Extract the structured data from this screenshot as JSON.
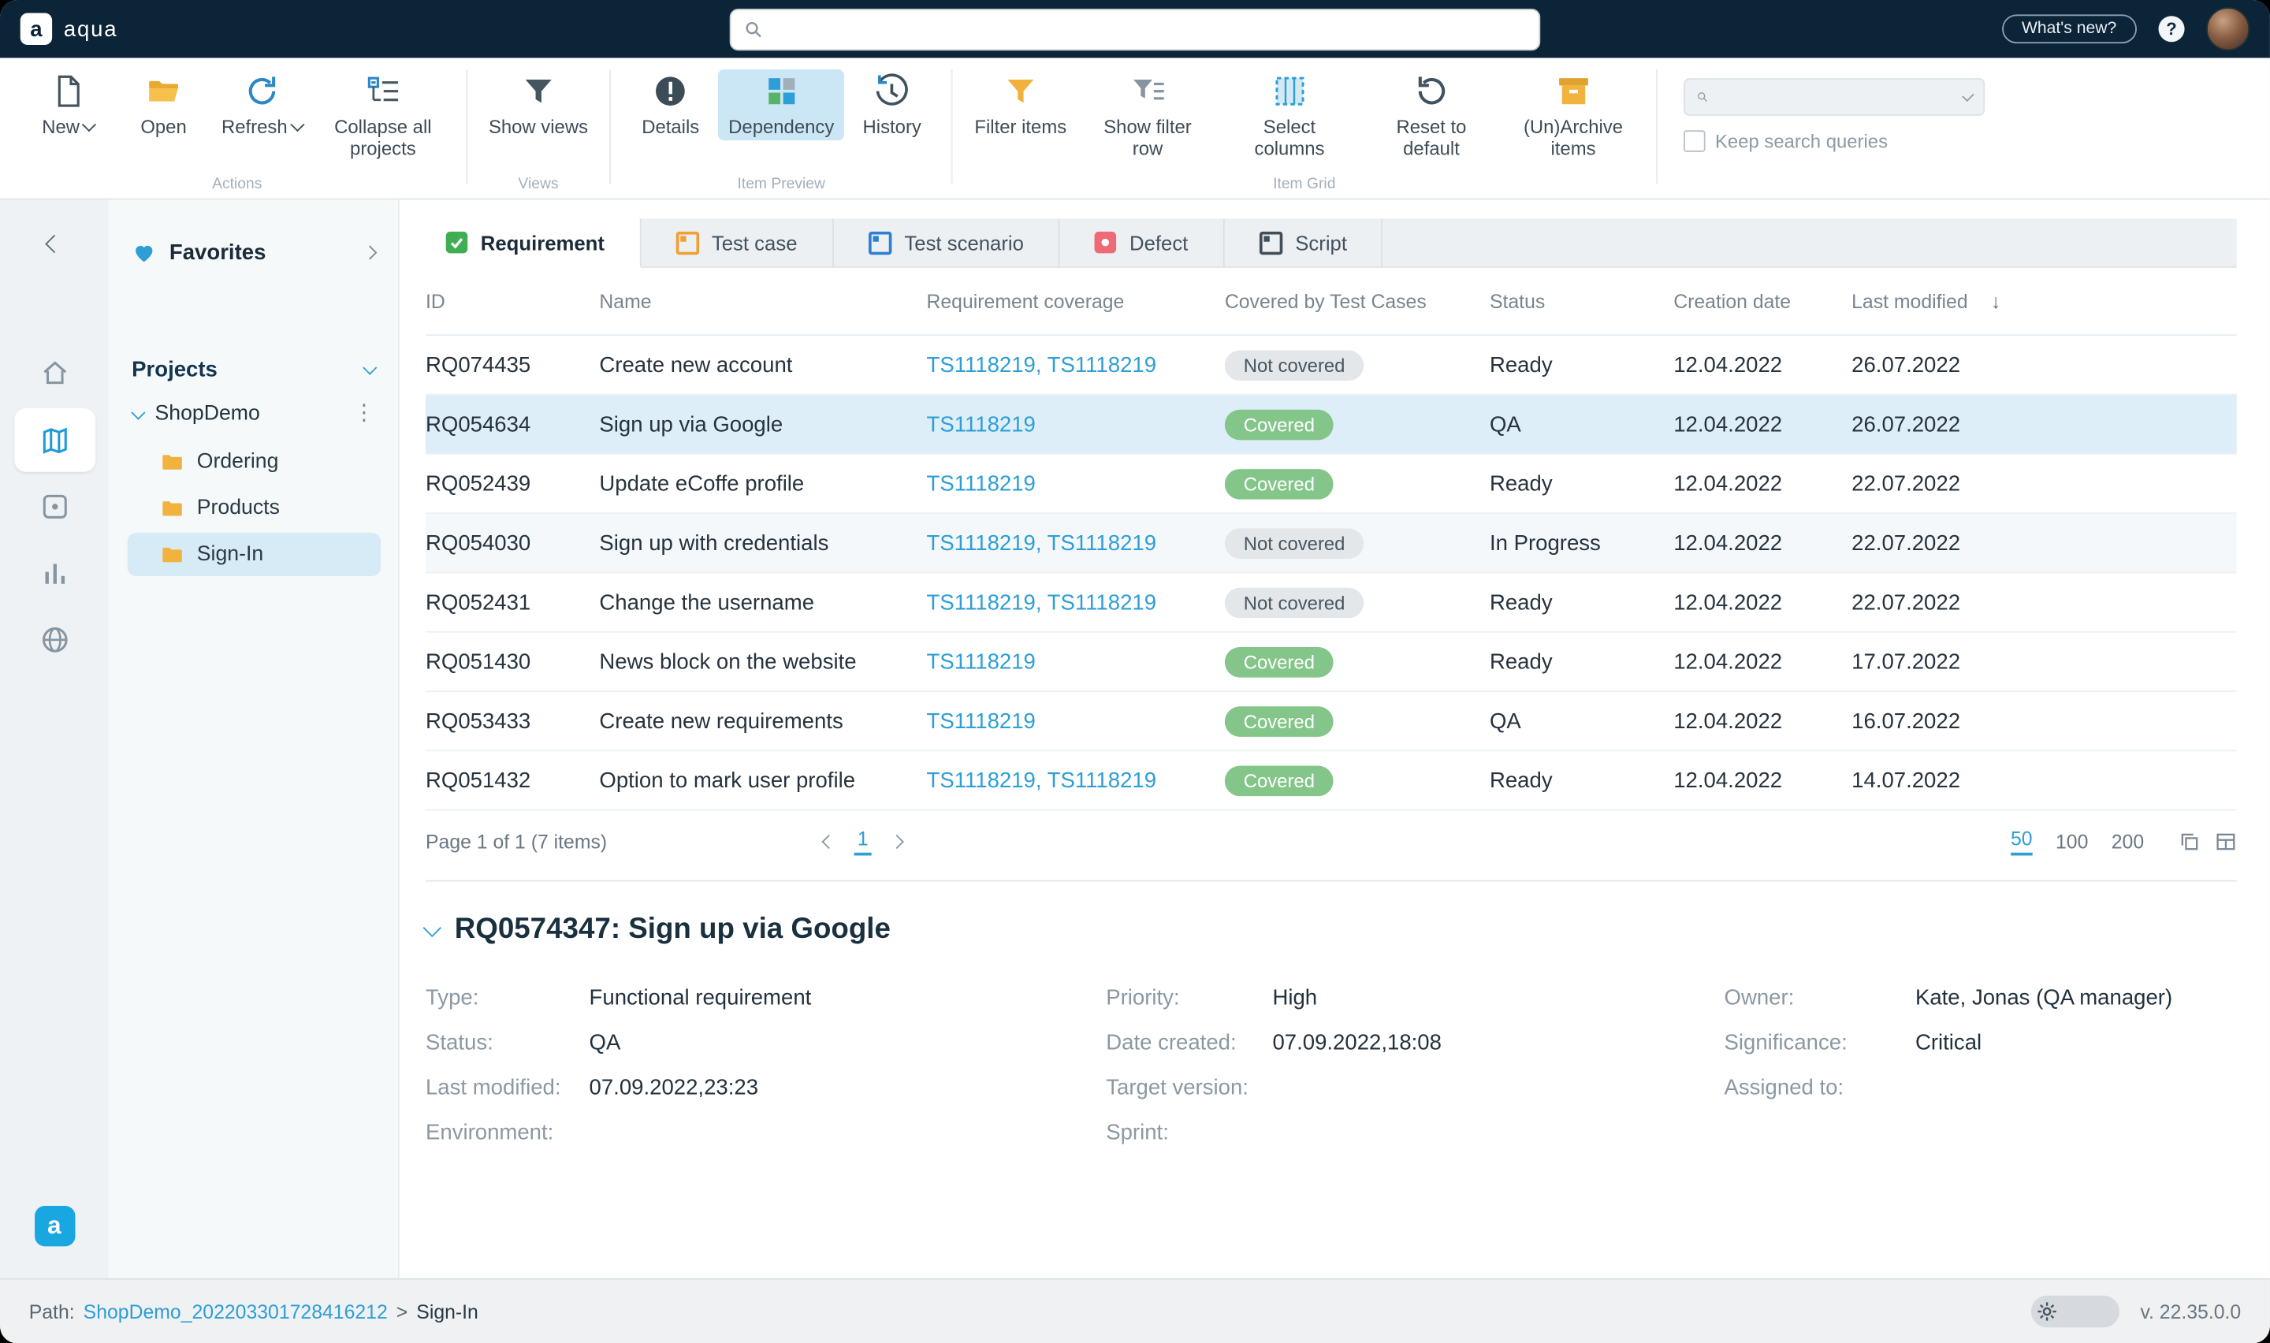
{
  "topbar": {
    "brand": "aqua",
    "logo_letter": "a",
    "whats_new": "What's new?",
    "help": "?"
  },
  "toolbar": {
    "buttons": [
      {
        "label": "New"
      },
      {
        "label": "Open"
      },
      {
        "label": "Refresh"
      },
      {
        "label": "Collapse all projects"
      },
      {
        "label": "Show views"
      },
      {
        "label": "Details"
      },
      {
        "label": "Dependency"
      },
      {
        "label": "History"
      },
      {
        "label": "Filter items"
      },
      {
        "label": "Show filter row"
      },
      {
        "label": "Select columns"
      },
      {
        "label": "Reset to default"
      },
      {
        "label": "(Un)Archive items"
      }
    ],
    "captions": {
      "actions": "Actions",
      "views": "Views",
      "item_preview": "Item Preview",
      "item_grid": "Item Grid"
    },
    "keep_search": "Keep search queries"
  },
  "sidebar": {
    "favorites": "Favorites",
    "projects": "Projects",
    "tree": {
      "root": "ShopDemo",
      "folders": [
        {
          "label": "Ordering"
        },
        {
          "label": "Products"
        },
        {
          "label": "Sign-In"
        }
      ]
    },
    "logo_letter": "a"
  },
  "tabs": [
    {
      "label": "Requirement"
    },
    {
      "label": "Test case"
    },
    {
      "label": "Test scenario"
    },
    {
      "label": "Defect"
    },
    {
      "label": "Script"
    }
  ],
  "table": {
    "headers": {
      "id": "ID",
      "name": "Name",
      "coverage": "Requirement coverage",
      "covered": "Covered by Test Cases",
      "status": "Status",
      "created": "Creation date",
      "modified": "Last modified",
      "sort_arrow": "↓"
    },
    "rows": [
      {
        "id": "RQ074435",
        "name": "Create new account",
        "coverage": "TS1118219, TS1118219",
        "covered": "Not covered",
        "status": "Ready",
        "created": "12.04.2022",
        "modified": "26.07.2022"
      },
      {
        "id": "RQ054634",
        "name": "Sign up via Google",
        "coverage": "TS1118219",
        "covered": "Covered",
        "status": "QA",
        "created": "12.04.2022",
        "modified": "26.07.2022"
      },
      {
        "id": "RQ052439",
        "name": "Update eCoffe profile",
        "coverage": "TS1118219",
        "covered": "Covered",
        "status": "Ready",
        "created": "12.04.2022",
        "modified": "22.07.2022"
      },
      {
        "id": "RQ054030",
        "name": "Sign up with credentials",
        "coverage": "TS1118219, TS1118219",
        "covered": "Not covered",
        "status": "In Progress",
        "created": "12.04.2022",
        "modified": "22.07.2022"
      },
      {
        "id": "RQ052431",
        "name": "Change the username",
        "coverage": "TS1118219, TS1118219",
        "covered": "Not covered",
        "status": "Ready",
        "created": "12.04.2022",
        "modified": "22.07.2022"
      },
      {
        "id": "RQ051430",
        "name": "News block on the website",
        "coverage": "TS1118219",
        "covered": "Covered",
        "status": "Ready",
        "created": "12.04.2022",
        "modified": "17.07.2022"
      },
      {
        "id": "RQ053433",
        "name": "Create new requirements",
        "coverage": "TS1118219",
        "covered": "Covered",
        "status": "QA",
        "created": "12.04.2022",
        "modified": "16.07.2022"
      },
      {
        "id": "RQ051432",
        "name": "Option to mark user profile",
        "coverage": "TS1118219, TS1118219",
        "covered": "Covered",
        "status": "Ready",
        "created": "12.04.2022",
        "modified": "14.07.2022"
      }
    ]
  },
  "pagination": {
    "info": "Page 1 of 1 (7 items)",
    "page": "1",
    "sizes": [
      {
        "label": "50"
      },
      {
        "label": "100"
      },
      {
        "label": "200"
      }
    ]
  },
  "detail": {
    "title": "RQ0574347: Sign up via Google",
    "col1": [
      {
        "label": "Type:",
        "value": "Functional requirement"
      },
      {
        "label": "Status:",
        "value": "QA"
      },
      {
        "label": "Last modified:",
        "value": "07.09.2022,23:23"
      },
      {
        "label": "Environment:",
        "value": ""
      }
    ],
    "col2": [
      {
        "label": "Priority:",
        "value": "High"
      },
      {
        "label": "Date created:",
        "value": "07.09.2022,18:08"
      },
      {
        "label": "Target version:",
        "value": ""
      },
      {
        "label": "Sprint:",
        "value": ""
      }
    ],
    "col3": [
      {
        "label": "Owner:",
        "value": "Kate, Jonas (QA manager)"
      },
      {
        "label": "Significance:",
        "value": "Critical"
      },
      {
        "label": "Assigned to:",
        "value": ""
      }
    ]
  },
  "footer": {
    "path_label": "Path:",
    "path_link": "ShopDemo_202203301728416212",
    "sep": ">",
    "current": "Sign-In",
    "version": "v. 22.35.0.0"
  }
}
